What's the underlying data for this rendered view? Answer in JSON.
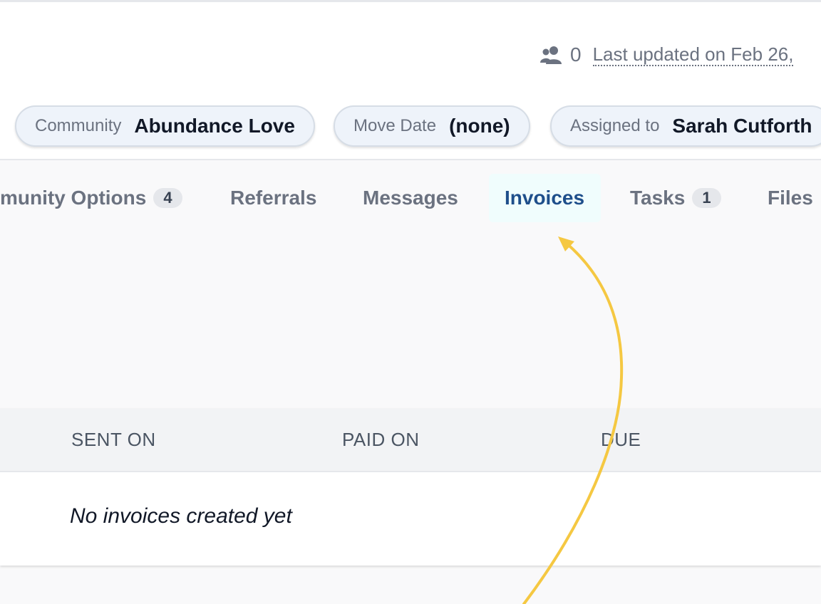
{
  "header": {
    "followers_icon": "users-icon",
    "followers_count": "0",
    "last_updated": "Last updated on Feb 26,"
  },
  "pills": [
    {
      "label": "Community",
      "value": "Abundance Love"
    },
    {
      "label": "Move Date",
      "value": "(none)"
    },
    {
      "label": "Assigned to",
      "value": "Sarah Cutforth"
    }
  ],
  "tabs": [
    {
      "label": "munity Options",
      "badge": "4"
    },
    {
      "label": "Referrals"
    },
    {
      "label": "Messages"
    },
    {
      "label": "Invoices",
      "active": true
    },
    {
      "label": "Tasks",
      "badge": "1"
    },
    {
      "label": "Files"
    }
  ],
  "table": {
    "columns": [
      "SENT ON",
      "PAID ON",
      "DUE"
    ],
    "empty_message": "No invoices created yet"
  },
  "colors": {
    "active_tab": "#1e4f8b",
    "active_tab_bg": "#f0fdfd",
    "pill_bg": "#eef3fa",
    "annotation_arrow": "#f5c842"
  }
}
